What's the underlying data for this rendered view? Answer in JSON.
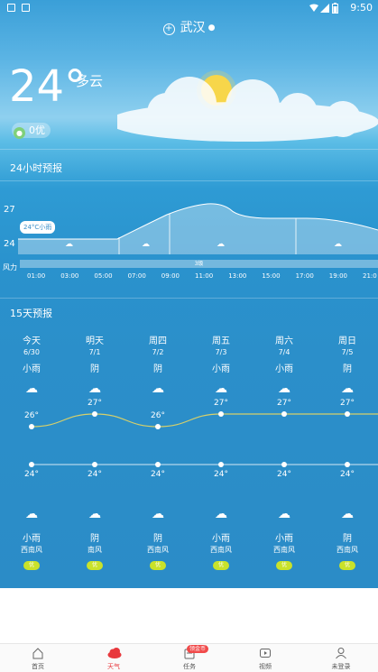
{
  "status_bar": {
    "time": "9:50"
  },
  "location": {
    "city": "武汉"
  },
  "current": {
    "temperature": "24°",
    "condition": "多云",
    "aqi": "0优"
  },
  "hourly": {
    "title": "24小时预报",
    "high_label": "27",
    "low_label": "24",
    "tooltip": "24°C小雨",
    "wind_label": "风力",
    "wind_level": "3级",
    "times": [
      "01:00",
      "03:00",
      "05:00",
      "07:00",
      "09:00",
      "11:00",
      "13:00",
      "15:00",
      "17:00",
      "19:00",
      "21:0"
    ],
    "icons": [
      "cloud-rain-icon",
      "cloud-rain-icon",
      "cloud-rain-icon",
      "cloud-rain-icon"
    ]
  },
  "forecast": {
    "title": "15天预报",
    "days": [
      {
        "name": "今天",
        "date": "6/30",
        "day_weather": "小雨",
        "high": "26°",
        "low": "24°",
        "night_weather": "小雨",
        "wind": "西南风",
        "aqi": "优",
        "high_value": 26,
        "low_value": 24
      },
      {
        "name": "明天",
        "date": "7/1",
        "day_weather": "阴",
        "high": "27°",
        "low": "24°",
        "night_weather": "阴",
        "wind": "南风",
        "aqi": "优",
        "high_value": 27,
        "low_value": 24
      },
      {
        "name": "周四",
        "date": "7/2",
        "day_weather": "阴",
        "high": "26°",
        "low": "24°",
        "night_weather": "阴",
        "wind": "西南风",
        "aqi": "优",
        "high_value": 26,
        "low_value": 24
      },
      {
        "name": "周五",
        "date": "7/3",
        "day_weather": "小雨",
        "high": "27°",
        "low": "24°",
        "night_weather": "小雨",
        "wind": "西南风",
        "aqi": "优",
        "high_value": 27,
        "low_value": 24
      },
      {
        "name": "周六",
        "date": "7/4",
        "day_weather": "小雨",
        "high": "27°",
        "low": "24°",
        "night_weather": "小雨",
        "wind": "西南风",
        "aqi": "优",
        "high_value": 27,
        "low_value": 24
      },
      {
        "name": "周日",
        "date": "7/5",
        "day_weather": "阴",
        "high": "27°",
        "low": "24°",
        "night_weather": "阴",
        "wind": "西南风",
        "aqi": "优",
        "high_value": 27,
        "low_value": 24
      }
    ]
  },
  "nav": [
    {
      "label": "首页",
      "icon": "home-icon",
      "active": false
    },
    {
      "label": "天气",
      "icon": "weather-cloud-icon",
      "active": true
    },
    {
      "label": "任务",
      "icon": "task-icon",
      "active": false,
      "badge": "领金币"
    },
    {
      "label": "视频",
      "icon": "video-icon",
      "active": false
    },
    {
      "label": "未登录",
      "icon": "user-icon",
      "active": false
    }
  ],
  "colors": {
    "accent": "#e8383d",
    "aqi_badge": "#c9e22a",
    "temp_line": "#d7d06a"
  }
}
